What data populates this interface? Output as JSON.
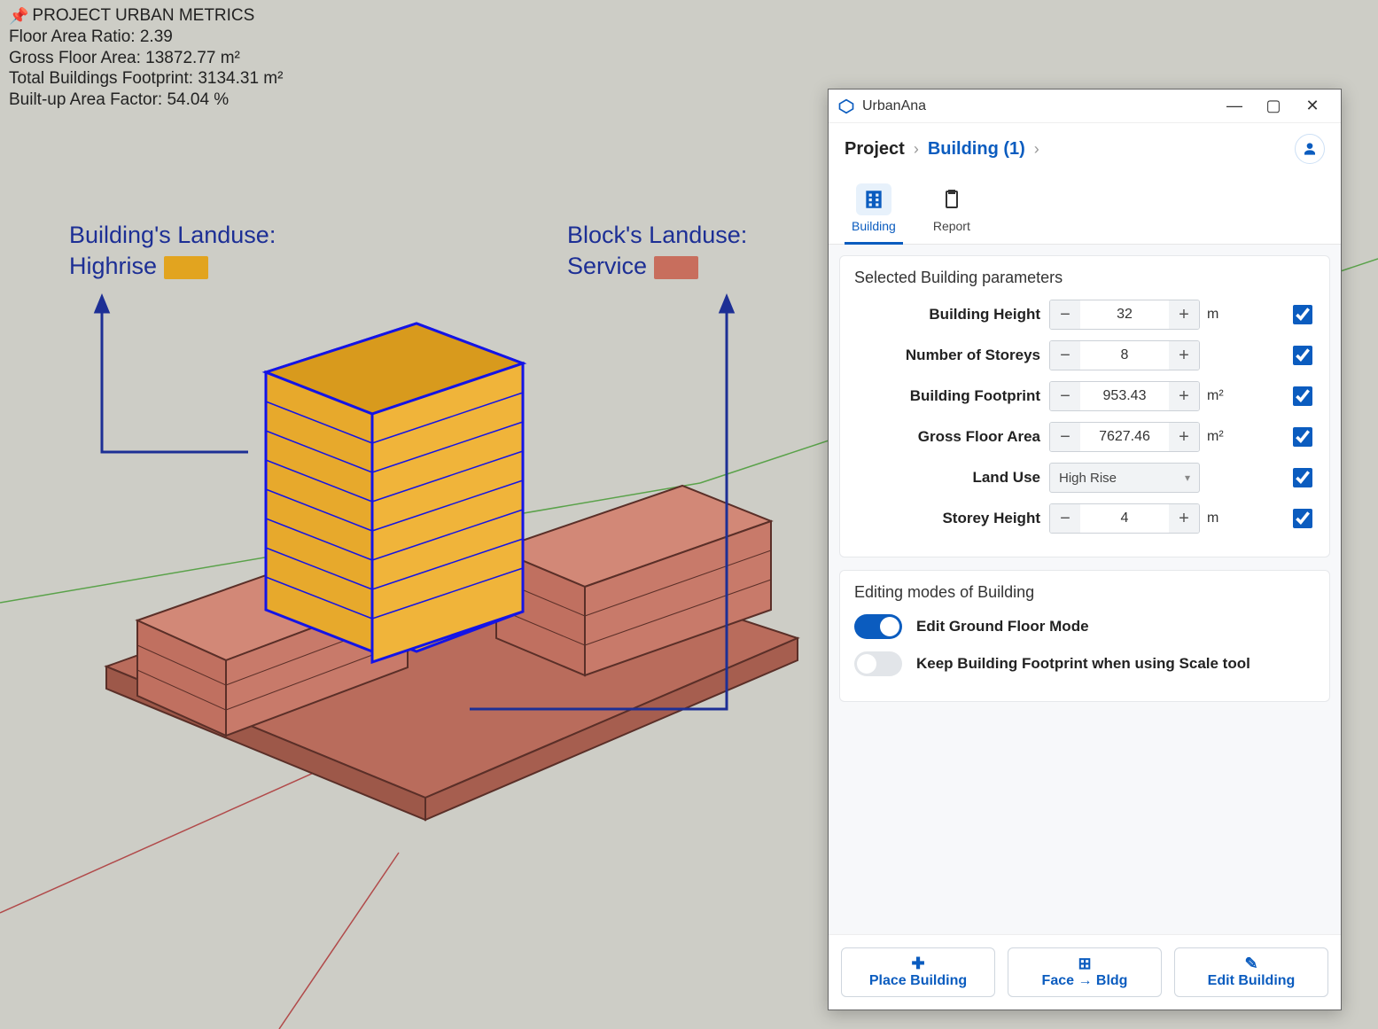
{
  "metrics": {
    "title": "PROJECT URBAN METRICS",
    "far_label": "Floor Area Ratio:",
    "far_value": "2.39",
    "gfa_label": "Gross Floor Area:",
    "gfa_value": "13872.77 m²",
    "footprint_label": "Total Buildings Footprint:",
    "footprint_value": "3134.31 m²",
    "builtup_label": "Built-up Area Factor:",
    "builtup_value": "54.04 %"
  },
  "annotations": {
    "building_label": "Building's Landuse:",
    "building_value": "Highrise",
    "building_color": "#e2a41f",
    "block_label": "Block's Landuse:",
    "block_value": "Service",
    "block_color": "#c86e5d"
  },
  "panel": {
    "app_name": "UrbanAna",
    "breadcrumb_root": "Project",
    "breadcrumb_current": "Building (1)",
    "tabs": {
      "building": "Building",
      "report": "Report"
    },
    "params_title": "Selected Building parameters",
    "params": {
      "height": {
        "label": "Building Height",
        "value": "32",
        "unit": "m"
      },
      "storeys": {
        "label": "Number of Storeys",
        "value": "8",
        "unit": ""
      },
      "footprint": {
        "label": "Building Footprint",
        "value": "953.43",
        "unit": "m²"
      },
      "gfa": {
        "label": "Gross Floor Area",
        "value": "7627.46",
        "unit": "m²"
      },
      "landuse": {
        "label": "Land Use",
        "value": "High Rise"
      },
      "storey_h": {
        "label": "Storey Height",
        "value": "4",
        "unit": "m"
      }
    },
    "modes_title": "Editing modes of Building",
    "modes": {
      "ground": {
        "label": "Edit Ground Floor Mode",
        "on": true
      },
      "keep_fp": {
        "label": "Keep Building Footprint when using Scale tool",
        "on": false
      }
    },
    "footer": {
      "place": "Place Building",
      "face": "Face → Bldg",
      "edit": "Edit Building"
    }
  }
}
